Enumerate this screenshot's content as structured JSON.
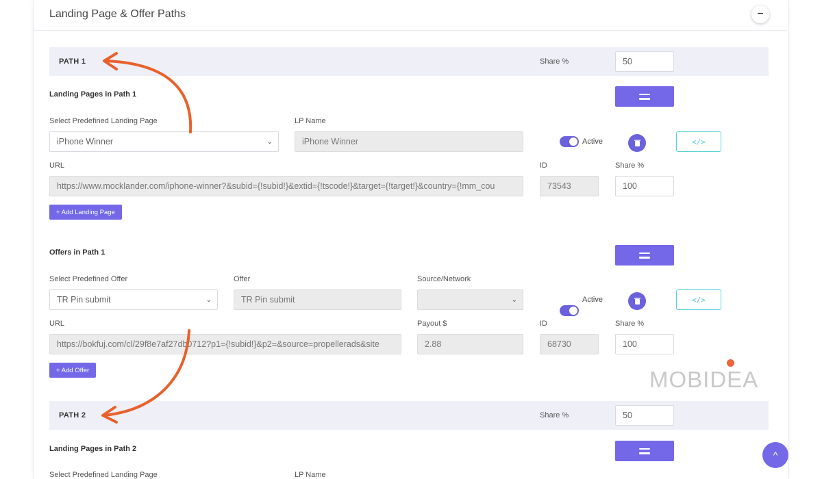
{
  "section": {
    "title": "Landing Page & Offer Paths",
    "collapse_icon": "−"
  },
  "path1": {
    "label": "PATH 1",
    "share_label": "Share %",
    "share_value": "50",
    "landing": {
      "heading": "Landing Pages in Path 1",
      "select_label": "Select Predefined Landing Page",
      "select_value": "iPhone Winner",
      "lp_name_label": "LP Name",
      "lp_name_value": "iPhone Winner",
      "active_label": "Active",
      "url_label": "URL",
      "url_value": "https://www.mocklander.com/iphone-winner?&subid={!subid!}&extid={!tscode!}&target={!target!}&country={!mm_cou",
      "id_label": "ID",
      "id_value": "73543",
      "share_label": "Share %",
      "share_value": "100",
      "add_button": "+ Add Landing Page"
    },
    "offers": {
      "heading": "Offers in Path 1",
      "select_label": "Select Predefined Offer",
      "select_value": "TR Pin submit",
      "offer_label": "Offer",
      "offer_value": "TR Pin submit",
      "source_label": "Source/Network",
      "source_value": "",
      "active_label": "Active",
      "url_label": "URL",
      "url_value": "https://bokfuj.com/cl/29f8e7af27db0712?p1={!subid!}&p2=&source=propellerads&site",
      "payout_label": "Payout $",
      "payout_value": "2.88",
      "id_label": "ID",
      "id_value": "68730",
      "share_label": "Share %",
      "share_value": "100",
      "add_button": "+ Add Offer"
    }
  },
  "path2": {
    "label": "PATH 2",
    "share_label": "Share %",
    "share_value": "50",
    "landing": {
      "heading": "Landing Pages in Path 2",
      "select_label": "Select Predefined Landing Page",
      "lp_name_label": "LP Name"
    }
  },
  "icons": {
    "code": "</>",
    "chevron": "⌄",
    "scroll_top": "^"
  },
  "watermark": {
    "text": "MOBIDEA"
  },
  "colors": {
    "accent": "#7468e8",
    "path_bar": "#efeff8",
    "code_border": "#5ad1d8",
    "arrow": "#e8612c",
    "watermark_dot": "#f0643a"
  }
}
